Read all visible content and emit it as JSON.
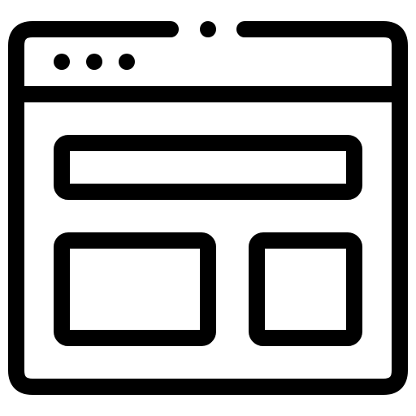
{
  "icon": {
    "name": "browser-window-layout-icon",
    "stroke_color": "#000000",
    "fill_color": "#ffffff",
    "window_dots": 3,
    "panels": [
      "header-panel",
      "left-panel",
      "right-panel"
    ]
  }
}
